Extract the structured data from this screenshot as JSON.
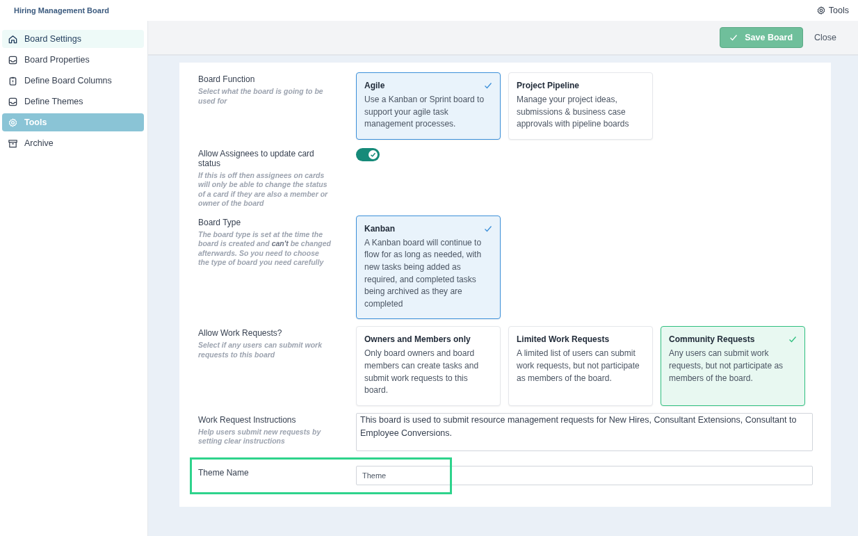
{
  "app_title": "Hiring Management Board",
  "top_tools": {
    "label": "Tools"
  },
  "sidebar": {
    "items": [
      {
        "label": "Board Settings",
        "selected": false,
        "hovered": true
      },
      {
        "label": "Board Properties",
        "selected": false,
        "hovered": false
      },
      {
        "label": "Define Board Columns",
        "selected": false,
        "hovered": false
      },
      {
        "label": "Define Themes",
        "selected": false,
        "hovered": false
      },
      {
        "label": "Tools",
        "selected": true,
        "hovered": false
      },
      {
        "label": "Archive",
        "selected": false,
        "hovered": false
      }
    ]
  },
  "header": {
    "buttons": [
      {
        "label": "Save Board",
        "kind": "primary"
      },
      {
        "label": "Close",
        "kind": "plain"
      }
    ]
  },
  "settings": [
    {
      "kind": "options",
      "label": "Board Function",
      "hint": "Select what the board is going to be used for",
      "options": [
        {
          "title": "Agile",
          "description": "Use a Kanban or Sprint board to support your agile task management processes.",
          "selected": true,
          "color": "#3b8fd9"
        },
        {
          "title": "Project Pipeline",
          "description": "Manage your project ideas, submissions & business case approvals with pipeline boards",
          "selected": false
        }
      ]
    },
    {
      "kind": "toggle",
      "label": "Allow Assignees to update card status",
      "hint": "If this is off then assignees on cards will only be able to change the status of a card if they are also a member or owner of the board",
      "on": true
    },
    {
      "kind": "options",
      "label": "Board Type",
      "hint": "The board type is set at the time the board is created and **can't** be changed afterwards. So you need to choose the type of board you need carefully",
      "options": [
        {
          "title": "Kanban",
          "description": "A Kanban board will continue to flow for as long as needed, with new tasks being added as required, and completed tasks being archived as they are completed",
          "selected": true,
          "color": "#3b8fd9"
        }
      ]
    },
    {
      "kind": "options",
      "label": "Allow Work Requests?",
      "hint": "Select if any users can submit work requests to this board",
      "options": [
        {
          "title": "Owners and Members only",
          "description": "Only board owners and board members can create tasks and submit work requests to this board.",
          "selected": false
        },
        {
          "title": "Limited Work Requests",
          "description": "A limited list of users can submit work requests, but not participate as members of the board.",
          "selected": false
        },
        {
          "title": "Community Requests",
          "description": "Any users can submit work requests, but not participate as members of the board.",
          "selected": true,
          "color": "#2fbf7f"
        }
      ]
    },
    {
      "kind": "textarea",
      "label": "Work Request Instructions",
      "hint": "Help users submit new requests by setting clear instructions",
      "value": "This board is used to submit resource management requests for New Hires, Consultant Extensions, Consultant to Employee Conversions."
    },
    {
      "kind": "input",
      "label": "Theme Name",
      "value": "Theme",
      "highlighted": true
    }
  ]
}
